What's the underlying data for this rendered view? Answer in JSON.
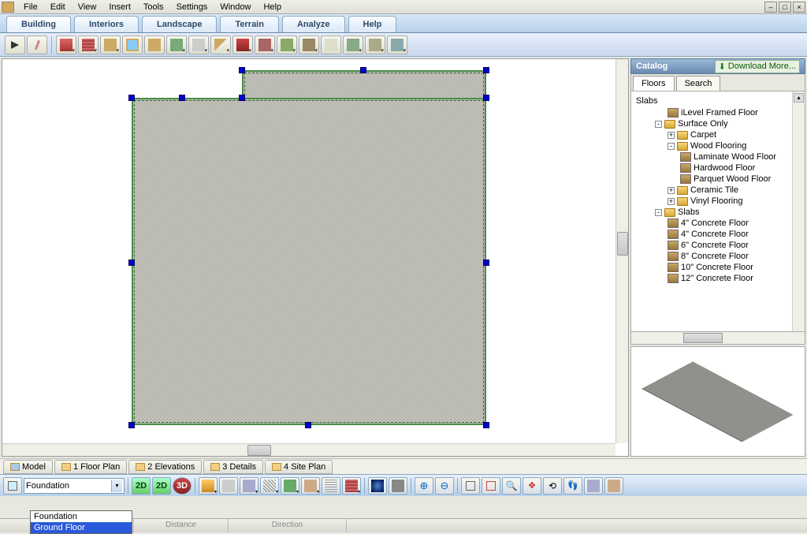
{
  "menubar": {
    "items": [
      "File",
      "Edit",
      "View",
      "Insert",
      "Tools",
      "Settings",
      "Window",
      "Help"
    ]
  },
  "maintabs": {
    "items": [
      "Building",
      "Interiors",
      "Landscape",
      "Terrain",
      "Analyze",
      "Help"
    ],
    "active": 0
  },
  "catalog": {
    "title": "Catalog",
    "download": "Download More...",
    "tabs": [
      "Floors",
      "Search"
    ],
    "active_tab": 0,
    "heading": "Slabs",
    "tree": [
      {
        "level": 2,
        "icon": "item",
        "label": "iLevel Framed Floor"
      },
      {
        "level": 1,
        "icon": "folder",
        "exp": "-",
        "label": "Surface Only"
      },
      {
        "level": 2,
        "icon": "folder",
        "exp": "+",
        "label": "Carpet"
      },
      {
        "level": 2,
        "icon": "folder",
        "exp": "-",
        "label": "Wood Flooring"
      },
      {
        "level": 3,
        "icon": "item",
        "label": "Laminate Wood Floor"
      },
      {
        "level": 3,
        "icon": "item",
        "label": "Hardwood Floor"
      },
      {
        "level": 3,
        "icon": "item",
        "label": "Parquet Wood Floor"
      },
      {
        "level": 2,
        "icon": "folder",
        "exp": "+",
        "label": "Ceramic Tile"
      },
      {
        "level": 2,
        "icon": "folder",
        "exp": "+",
        "label": "Vinyl Flooring"
      },
      {
        "level": 1,
        "icon": "folder",
        "exp": "-",
        "label": "Slabs"
      },
      {
        "level": 2,
        "icon": "item",
        "label": "4\" Concrete Floor"
      },
      {
        "level": 2,
        "icon": "item",
        "label": "4\" Concrete Floor"
      },
      {
        "level": 2,
        "icon": "item",
        "label": "6\" Concrete Floor"
      },
      {
        "level": 2,
        "icon": "item",
        "label": "8\" Concrete Floor"
      },
      {
        "level": 2,
        "icon": "item",
        "label": "10\" Concrete Floor"
      },
      {
        "level": 2,
        "icon": "item",
        "label": "12\" Concrete Floor"
      }
    ]
  },
  "viewtabs": {
    "items": [
      "Model",
      "1 Floor Plan",
      "2 Elevations",
      "3 Details",
      "4 Site Plan"
    ]
  },
  "level_selector": {
    "current": "Foundation",
    "options": [
      "Foundation",
      "Ground Floor"
    ],
    "highlighted": 1
  },
  "bottombar_labels": {
    "2d": "2D",
    "3d": "3D"
  },
  "statusbar": {
    "distance": "Distance",
    "direction": "Direction"
  },
  "toolbar_icons": [
    "select",
    "paint",
    "house",
    "wall",
    "column",
    "window",
    "door",
    "floor",
    "stair",
    "roof",
    "roof2",
    "roof3",
    "dormer",
    "trim",
    "post",
    "rail",
    "rail2",
    "ext"
  ]
}
